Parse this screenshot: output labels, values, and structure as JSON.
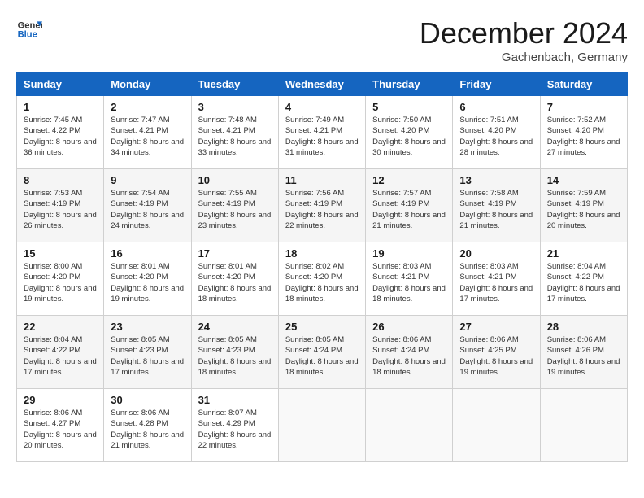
{
  "header": {
    "logo_line1": "General",
    "logo_line2": "Blue",
    "month_title": "December 2024",
    "location": "Gachenbach, Germany"
  },
  "weekdays": [
    "Sunday",
    "Monday",
    "Tuesday",
    "Wednesday",
    "Thursday",
    "Friday",
    "Saturday"
  ],
  "weeks": [
    [
      {
        "day": "1",
        "sunrise": "7:45 AM",
        "sunset": "4:22 PM",
        "daylight": "8 hours and 36 minutes."
      },
      {
        "day": "2",
        "sunrise": "7:47 AM",
        "sunset": "4:21 PM",
        "daylight": "8 hours and 34 minutes."
      },
      {
        "day": "3",
        "sunrise": "7:48 AM",
        "sunset": "4:21 PM",
        "daylight": "8 hours and 33 minutes."
      },
      {
        "day": "4",
        "sunrise": "7:49 AM",
        "sunset": "4:21 PM",
        "daylight": "8 hours and 31 minutes."
      },
      {
        "day": "5",
        "sunrise": "7:50 AM",
        "sunset": "4:20 PM",
        "daylight": "8 hours and 30 minutes."
      },
      {
        "day": "6",
        "sunrise": "7:51 AM",
        "sunset": "4:20 PM",
        "daylight": "8 hours and 28 minutes."
      },
      {
        "day": "7",
        "sunrise": "7:52 AM",
        "sunset": "4:20 PM",
        "daylight": "8 hours and 27 minutes."
      }
    ],
    [
      {
        "day": "8",
        "sunrise": "7:53 AM",
        "sunset": "4:19 PM",
        "daylight": "8 hours and 26 minutes."
      },
      {
        "day": "9",
        "sunrise": "7:54 AM",
        "sunset": "4:19 PM",
        "daylight": "8 hours and 24 minutes."
      },
      {
        "day": "10",
        "sunrise": "7:55 AM",
        "sunset": "4:19 PM",
        "daylight": "8 hours and 23 minutes."
      },
      {
        "day": "11",
        "sunrise": "7:56 AM",
        "sunset": "4:19 PM",
        "daylight": "8 hours and 22 minutes."
      },
      {
        "day": "12",
        "sunrise": "7:57 AM",
        "sunset": "4:19 PM",
        "daylight": "8 hours and 21 minutes."
      },
      {
        "day": "13",
        "sunrise": "7:58 AM",
        "sunset": "4:19 PM",
        "daylight": "8 hours and 21 minutes."
      },
      {
        "day": "14",
        "sunrise": "7:59 AM",
        "sunset": "4:19 PM",
        "daylight": "8 hours and 20 minutes."
      }
    ],
    [
      {
        "day": "15",
        "sunrise": "8:00 AM",
        "sunset": "4:20 PM",
        "daylight": "8 hours and 19 minutes."
      },
      {
        "day": "16",
        "sunrise": "8:01 AM",
        "sunset": "4:20 PM",
        "daylight": "8 hours and 19 minutes."
      },
      {
        "day": "17",
        "sunrise": "8:01 AM",
        "sunset": "4:20 PM",
        "daylight": "8 hours and 18 minutes."
      },
      {
        "day": "18",
        "sunrise": "8:02 AM",
        "sunset": "4:20 PM",
        "daylight": "8 hours and 18 minutes."
      },
      {
        "day": "19",
        "sunrise": "8:03 AM",
        "sunset": "4:21 PM",
        "daylight": "8 hours and 18 minutes."
      },
      {
        "day": "20",
        "sunrise": "8:03 AM",
        "sunset": "4:21 PM",
        "daylight": "8 hours and 17 minutes."
      },
      {
        "day": "21",
        "sunrise": "8:04 AM",
        "sunset": "4:22 PM",
        "daylight": "8 hours and 17 minutes."
      }
    ],
    [
      {
        "day": "22",
        "sunrise": "8:04 AM",
        "sunset": "4:22 PM",
        "daylight": "8 hours and 17 minutes."
      },
      {
        "day": "23",
        "sunrise": "8:05 AM",
        "sunset": "4:23 PM",
        "daylight": "8 hours and 17 minutes."
      },
      {
        "day": "24",
        "sunrise": "8:05 AM",
        "sunset": "4:23 PM",
        "daylight": "8 hours and 18 minutes."
      },
      {
        "day": "25",
        "sunrise": "8:05 AM",
        "sunset": "4:24 PM",
        "daylight": "8 hours and 18 minutes."
      },
      {
        "day": "26",
        "sunrise": "8:06 AM",
        "sunset": "4:24 PM",
        "daylight": "8 hours and 18 minutes."
      },
      {
        "day": "27",
        "sunrise": "8:06 AM",
        "sunset": "4:25 PM",
        "daylight": "8 hours and 19 minutes."
      },
      {
        "day": "28",
        "sunrise": "8:06 AM",
        "sunset": "4:26 PM",
        "daylight": "8 hours and 19 minutes."
      }
    ],
    [
      {
        "day": "29",
        "sunrise": "8:06 AM",
        "sunset": "4:27 PM",
        "daylight": "8 hours and 20 minutes."
      },
      {
        "day": "30",
        "sunrise": "8:06 AM",
        "sunset": "4:28 PM",
        "daylight": "8 hours and 21 minutes."
      },
      {
        "day": "31",
        "sunrise": "8:07 AM",
        "sunset": "4:29 PM",
        "daylight": "8 hours and 22 minutes."
      },
      null,
      null,
      null,
      null
    ]
  ]
}
